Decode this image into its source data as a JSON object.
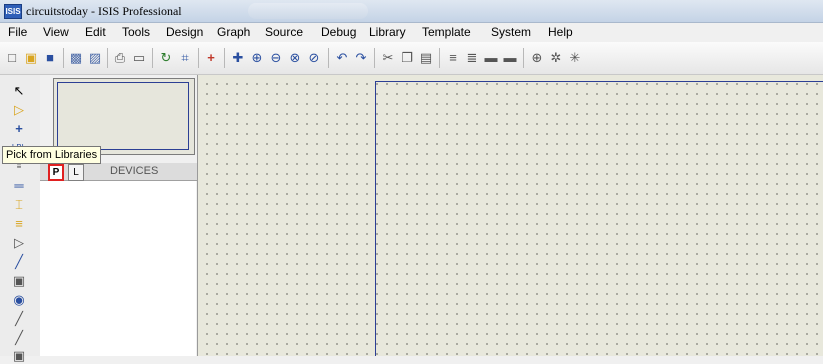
{
  "window": {
    "title": "circuitstoday - ISIS Professional",
    "icon_text": "ISIS"
  },
  "menu": [
    {
      "label": "File"
    },
    {
      "label": "View"
    },
    {
      "label": "Edit"
    },
    {
      "label": "Tools"
    },
    {
      "label": "Design"
    },
    {
      "label": "Graph"
    },
    {
      "label": "Source"
    },
    {
      "label": "Debug"
    },
    {
      "label": "Library"
    },
    {
      "label": "Template"
    },
    {
      "label": "System"
    },
    {
      "label": "Help"
    }
  ],
  "toolbar_icons": [
    "new-file-icon",
    "open-folder-icon",
    "save-icon",
    "import-icon",
    "export-icon",
    "print-icon",
    "set-area-icon",
    "refresh-icon",
    "grid-icon",
    "origin-icon",
    "pan-icon",
    "zoom-in-icon",
    "zoom-out-icon",
    "zoom-all-icon",
    "zoom-area-icon",
    "undo-icon",
    "redo-icon",
    "cut-icon",
    "copy-icon",
    "paste-icon",
    "block-copy-icon",
    "block-move-icon",
    "block-rotate-icon",
    "block-delete-icon",
    "pick-device-icon",
    "make-device-icon",
    "packaging-icon"
  ],
  "mode_tools": [
    "selection-icon",
    "component-icon",
    "junction-icon",
    "wire-label-icon",
    "text-script-icon",
    "bus-icon",
    "subcircuit-icon",
    "terminal-icon",
    "device-pin-icon",
    "graph-icon",
    "tape-recorder-icon",
    "generator-icon",
    "voltage-probe-icon",
    "current-probe-icon",
    "virtual-instrument-icon"
  ],
  "tooltip": {
    "text": "Pick from Libraries"
  },
  "device_panel": {
    "pick_label": "P",
    "library_label": "L",
    "title": "DEVICES"
  },
  "colors": {
    "sheet_border": "#2c3f94",
    "canvas_bg": "#e8e8dc",
    "pick_highlight": "#e02020"
  }
}
